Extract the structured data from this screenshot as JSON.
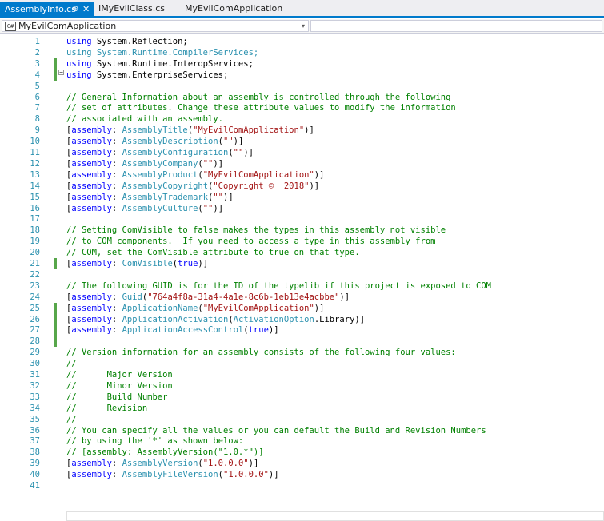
{
  "tabs": [
    {
      "label": "AssemblyInfo.cs",
      "pin_icon": "pin-icon",
      "close_icon": "close-icon",
      "pin_glyph": "⊕",
      "close_glyph": "✕",
      "active": true
    },
    {
      "label": "IMyEvilClass.cs",
      "active": false
    },
    {
      "label": "MyEvilComApplication",
      "active": false
    }
  ],
  "nav": {
    "project": "MyEvilComApplication",
    "project_icon": "C#",
    "arrow": "▾"
  },
  "editor": {
    "collapse_glyph": "−",
    "lines": [
      {
        "n": "1",
        "changed": false,
        "tokens": [
          {
            "c": "kw",
            "t": "using"
          },
          {
            "c": "plain",
            "t": " System.Reflection;"
          }
        ]
      },
      {
        "n": "2",
        "changed": false,
        "tokens": [
          {
            "c": "ty",
            "t": "using System.Runtime.CompilerServices;"
          }
        ]
      },
      {
        "n": "3",
        "changed": true,
        "tokens": [
          {
            "c": "kw",
            "t": "using"
          },
          {
            "c": "plain",
            "t": " System.Runtime.InteropServices;"
          }
        ]
      },
      {
        "n": "4",
        "changed": true,
        "tokens": [
          {
            "c": "kw",
            "t": "using"
          },
          {
            "c": "plain",
            "t": " System.EnterpriseServices;"
          }
        ]
      },
      {
        "n": "5",
        "changed": false,
        "tokens": []
      },
      {
        "n": "6",
        "changed": false,
        "tokens": [
          {
            "c": "cm",
            "t": "// General Information about an assembly is controlled through the following"
          }
        ]
      },
      {
        "n": "7",
        "changed": false,
        "tokens": [
          {
            "c": "cm",
            "t": "// set of attributes. Change these attribute values to modify the information"
          }
        ]
      },
      {
        "n": "8",
        "changed": false,
        "tokens": [
          {
            "c": "cm",
            "t": "// associated with an assembly."
          }
        ]
      },
      {
        "n": "9",
        "changed": false,
        "tokens": [
          {
            "c": "plain",
            "t": "["
          },
          {
            "c": "kw",
            "t": "assembly"
          },
          {
            "c": "plain",
            "t": ": "
          },
          {
            "c": "ty",
            "t": "AssemblyTitle"
          },
          {
            "c": "plain",
            "t": "("
          },
          {
            "c": "st",
            "t": "\"MyEvilComApplication\""
          },
          {
            "c": "plain",
            "t": ")]"
          }
        ]
      },
      {
        "n": "10",
        "changed": false,
        "tokens": [
          {
            "c": "plain",
            "t": "["
          },
          {
            "c": "kw",
            "t": "assembly"
          },
          {
            "c": "plain",
            "t": ": "
          },
          {
            "c": "ty",
            "t": "AssemblyDescription"
          },
          {
            "c": "plain",
            "t": "("
          },
          {
            "c": "st",
            "t": "\"\""
          },
          {
            "c": "plain",
            "t": ")]"
          }
        ]
      },
      {
        "n": "11",
        "changed": false,
        "tokens": [
          {
            "c": "plain",
            "t": "["
          },
          {
            "c": "kw",
            "t": "assembly"
          },
          {
            "c": "plain",
            "t": ": "
          },
          {
            "c": "ty",
            "t": "AssemblyConfiguration"
          },
          {
            "c": "plain",
            "t": "("
          },
          {
            "c": "st",
            "t": "\"\""
          },
          {
            "c": "plain",
            "t": ")]"
          }
        ]
      },
      {
        "n": "12",
        "changed": false,
        "tokens": [
          {
            "c": "plain",
            "t": "["
          },
          {
            "c": "kw",
            "t": "assembly"
          },
          {
            "c": "plain",
            "t": ": "
          },
          {
            "c": "ty",
            "t": "AssemblyCompany"
          },
          {
            "c": "plain",
            "t": "("
          },
          {
            "c": "st",
            "t": "\"\""
          },
          {
            "c": "plain",
            "t": ")]"
          }
        ]
      },
      {
        "n": "13",
        "changed": false,
        "tokens": [
          {
            "c": "plain",
            "t": "["
          },
          {
            "c": "kw",
            "t": "assembly"
          },
          {
            "c": "plain",
            "t": ": "
          },
          {
            "c": "ty",
            "t": "AssemblyProduct"
          },
          {
            "c": "plain",
            "t": "("
          },
          {
            "c": "st",
            "t": "\"MyEvilComApplication\""
          },
          {
            "c": "plain",
            "t": ")]"
          }
        ]
      },
      {
        "n": "14",
        "changed": false,
        "tokens": [
          {
            "c": "plain",
            "t": "["
          },
          {
            "c": "kw",
            "t": "assembly"
          },
          {
            "c": "plain",
            "t": ": "
          },
          {
            "c": "ty",
            "t": "AssemblyCopyright"
          },
          {
            "c": "plain",
            "t": "("
          },
          {
            "c": "st",
            "t": "\"Copyright ©  2018\""
          },
          {
            "c": "plain",
            "t": ")]"
          }
        ]
      },
      {
        "n": "15",
        "changed": false,
        "tokens": [
          {
            "c": "plain",
            "t": "["
          },
          {
            "c": "kw",
            "t": "assembly"
          },
          {
            "c": "plain",
            "t": ": "
          },
          {
            "c": "ty",
            "t": "AssemblyTrademark"
          },
          {
            "c": "plain",
            "t": "("
          },
          {
            "c": "st",
            "t": "\"\""
          },
          {
            "c": "plain",
            "t": ")]"
          }
        ]
      },
      {
        "n": "16",
        "changed": false,
        "tokens": [
          {
            "c": "plain",
            "t": "["
          },
          {
            "c": "kw",
            "t": "assembly"
          },
          {
            "c": "plain",
            "t": ": "
          },
          {
            "c": "ty",
            "t": "AssemblyCulture"
          },
          {
            "c": "plain",
            "t": "("
          },
          {
            "c": "st",
            "t": "\"\""
          },
          {
            "c": "plain",
            "t": ")]"
          }
        ]
      },
      {
        "n": "17",
        "changed": false,
        "tokens": []
      },
      {
        "n": "18",
        "changed": false,
        "tokens": [
          {
            "c": "cm",
            "t": "// Setting ComVisible to false makes the types in this assembly not visible"
          }
        ]
      },
      {
        "n": "19",
        "changed": false,
        "tokens": [
          {
            "c": "cm",
            "t": "// to COM components.  If you need to access a type in this assembly from"
          }
        ]
      },
      {
        "n": "20",
        "changed": false,
        "tokens": [
          {
            "c": "cm",
            "t": "// COM, set the ComVisible attribute to true on that type."
          }
        ]
      },
      {
        "n": "21",
        "changed": true,
        "tokens": [
          {
            "c": "plain",
            "t": "["
          },
          {
            "c": "kw",
            "t": "assembly"
          },
          {
            "c": "plain",
            "t": ": "
          },
          {
            "c": "ty",
            "t": "ComVisible"
          },
          {
            "c": "plain",
            "t": "("
          },
          {
            "c": "kw",
            "t": "true"
          },
          {
            "c": "plain",
            "t": ")]"
          }
        ]
      },
      {
        "n": "22",
        "changed": false,
        "tokens": []
      },
      {
        "n": "23",
        "changed": false,
        "tokens": [
          {
            "c": "cm",
            "t": "// The following GUID is for the ID of the typelib if this project is exposed to COM"
          }
        ]
      },
      {
        "n": "24",
        "changed": false,
        "tokens": [
          {
            "c": "plain",
            "t": "["
          },
          {
            "c": "kw",
            "t": "assembly"
          },
          {
            "c": "plain",
            "t": ": "
          },
          {
            "c": "ty",
            "t": "Guid"
          },
          {
            "c": "plain",
            "t": "("
          },
          {
            "c": "st",
            "t": "\"764a4f8a-31a4-4a1e-8c6b-1eb13e4acbbe\""
          },
          {
            "c": "plain",
            "t": ")]"
          }
        ]
      },
      {
        "n": "25",
        "changed": true,
        "tokens": [
          {
            "c": "plain",
            "t": "["
          },
          {
            "c": "kw",
            "t": "assembly"
          },
          {
            "c": "plain",
            "t": ": "
          },
          {
            "c": "ty",
            "t": "ApplicationName"
          },
          {
            "c": "plain",
            "t": "("
          },
          {
            "c": "st",
            "t": "\"MyEvilComApplication\""
          },
          {
            "c": "plain",
            "t": ")]"
          }
        ]
      },
      {
        "n": "26",
        "changed": true,
        "tokens": [
          {
            "c": "plain",
            "t": "["
          },
          {
            "c": "kw",
            "t": "assembly"
          },
          {
            "c": "plain",
            "t": ": "
          },
          {
            "c": "ty",
            "t": "ApplicationActivation"
          },
          {
            "c": "plain",
            "t": "("
          },
          {
            "c": "ty",
            "t": "ActivationOption"
          },
          {
            "c": "plain",
            "t": ".Library)]"
          }
        ]
      },
      {
        "n": "27",
        "changed": true,
        "tokens": [
          {
            "c": "plain",
            "t": "["
          },
          {
            "c": "kw",
            "t": "assembly"
          },
          {
            "c": "plain",
            "t": ": "
          },
          {
            "c": "ty",
            "t": "ApplicationAccessControl"
          },
          {
            "c": "plain",
            "t": "("
          },
          {
            "c": "kw",
            "t": "true"
          },
          {
            "c": "plain",
            "t": ")]"
          }
        ]
      },
      {
        "n": "28",
        "changed": true,
        "tokens": []
      },
      {
        "n": "29",
        "changed": false,
        "tokens": [
          {
            "c": "cm",
            "t": "// Version information for an assembly consists of the following four values:"
          }
        ]
      },
      {
        "n": "30",
        "changed": false,
        "tokens": [
          {
            "c": "cm",
            "t": "//"
          }
        ]
      },
      {
        "n": "31",
        "changed": false,
        "tokens": [
          {
            "c": "cm",
            "t": "//      Major Version"
          }
        ]
      },
      {
        "n": "32",
        "changed": false,
        "tokens": [
          {
            "c": "cm",
            "t": "//      Minor Version"
          }
        ]
      },
      {
        "n": "33",
        "changed": false,
        "tokens": [
          {
            "c": "cm",
            "t": "//      Build Number"
          }
        ]
      },
      {
        "n": "34",
        "changed": false,
        "tokens": [
          {
            "c": "cm",
            "t": "//      Revision"
          }
        ]
      },
      {
        "n": "35",
        "changed": false,
        "tokens": [
          {
            "c": "cm",
            "t": "//"
          }
        ]
      },
      {
        "n": "36",
        "changed": false,
        "tokens": [
          {
            "c": "cm",
            "t": "// You can specify all the values or you can default the Build and Revision Numbers"
          }
        ]
      },
      {
        "n": "37",
        "changed": false,
        "tokens": [
          {
            "c": "cm",
            "t": "// by using the '*' as shown below:"
          }
        ]
      },
      {
        "n": "38",
        "changed": false,
        "tokens": [
          {
            "c": "cm",
            "t": "// [assembly: AssemblyVersion(\"1.0.*\")]"
          }
        ]
      },
      {
        "n": "39",
        "changed": false,
        "tokens": [
          {
            "c": "plain",
            "t": "["
          },
          {
            "c": "kw",
            "t": "assembly"
          },
          {
            "c": "plain",
            "t": ": "
          },
          {
            "c": "ty",
            "t": "AssemblyVersion"
          },
          {
            "c": "plain",
            "t": "("
          },
          {
            "c": "st",
            "t": "\"1.0.0.0\""
          },
          {
            "c": "plain",
            "t": ")]"
          }
        ]
      },
      {
        "n": "40",
        "changed": false,
        "tokens": [
          {
            "c": "plain",
            "t": "["
          },
          {
            "c": "kw",
            "t": "assembly"
          },
          {
            "c": "plain",
            "t": ": "
          },
          {
            "c": "ty",
            "t": "AssemblyFileVersion"
          },
          {
            "c": "plain",
            "t": "("
          },
          {
            "c": "st",
            "t": "\"1.0.0.0\""
          },
          {
            "c": "plain",
            "t": ")]"
          }
        ]
      },
      {
        "n": "41",
        "changed": false,
        "tokens": []
      }
    ]
  },
  "colors": {
    "tab_active": "#007acc",
    "keyword": "#0000ff",
    "type": "#2b91af",
    "string": "#a31515",
    "comment": "#008000",
    "line_number": "#2b91af",
    "change_marker": "#57a64a"
  }
}
